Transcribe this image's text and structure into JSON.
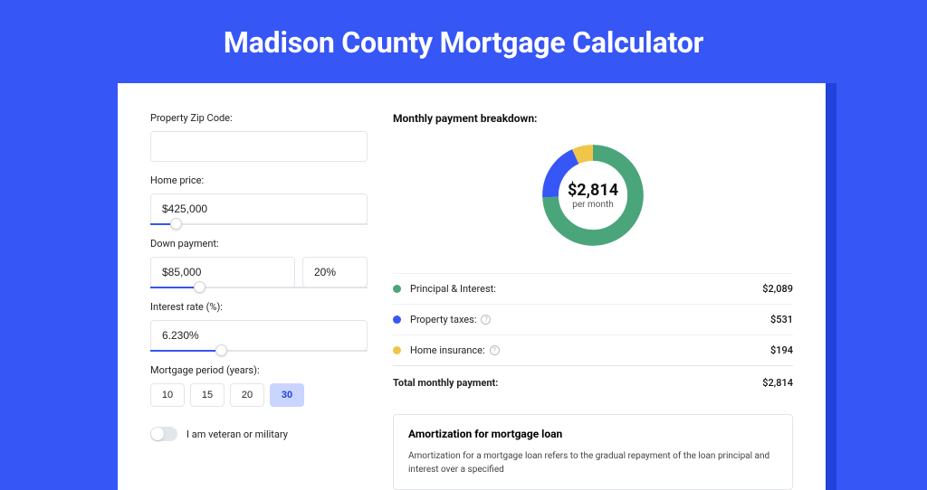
{
  "title": "Madison County Mortgage Calculator",
  "form": {
    "zip_label": "Property Zip Code:",
    "zip_value": "",
    "home_price_label": "Home price:",
    "home_price_value": "$425,000",
    "home_price_slider_pct": 9,
    "down_label": "Down payment:",
    "down_value": "$85,000",
    "down_pct_value": "20%",
    "down_slider_pct": 20,
    "rate_label": "Interest rate (%):",
    "rate_value": "6.230%",
    "rate_slider_pct": 30,
    "period_label": "Mortgage period (years):",
    "periods": [
      "10",
      "15",
      "20",
      "30"
    ],
    "period_active": "30",
    "veteran_label": "I am veteran or military"
  },
  "breakdown": {
    "title": "Monthly payment breakdown:",
    "donut_amount": "$2,814",
    "donut_sub": "per month",
    "items": [
      {
        "label": "Principal & Interest:",
        "value": "$2,089",
        "color": "green",
        "help": false
      },
      {
        "label": "Property taxes:",
        "value": "$531",
        "color": "blue",
        "help": true
      },
      {
        "label": "Home insurance:",
        "value": "$194",
        "color": "yellow",
        "help": true
      }
    ],
    "total_label": "Total monthly payment:",
    "total_value": "$2,814"
  },
  "amort": {
    "title": "Amortization for mortgage loan",
    "text": "Amortization for a mortgage loan refers to the gradual repayment of the loan principal and interest over a specified"
  },
  "chart_data": {
    "type": "pie",
    "title": "Monthly payment breakdown",
    "series": [
      {
        "name": "Principal & Interest",
        "value": 2089,
        "color": "#4aa57a"
      },
      {
        "name": "Property taxes",
        "value": 531,
        "color": "#3656f5"
      },
      {
        "name": "Home insurance",
        "value": 194,
        "color": "#f1c54a"
      }
    ],
    "total": 2814,
    "center_label": "$2,814 per month"
  }
}
